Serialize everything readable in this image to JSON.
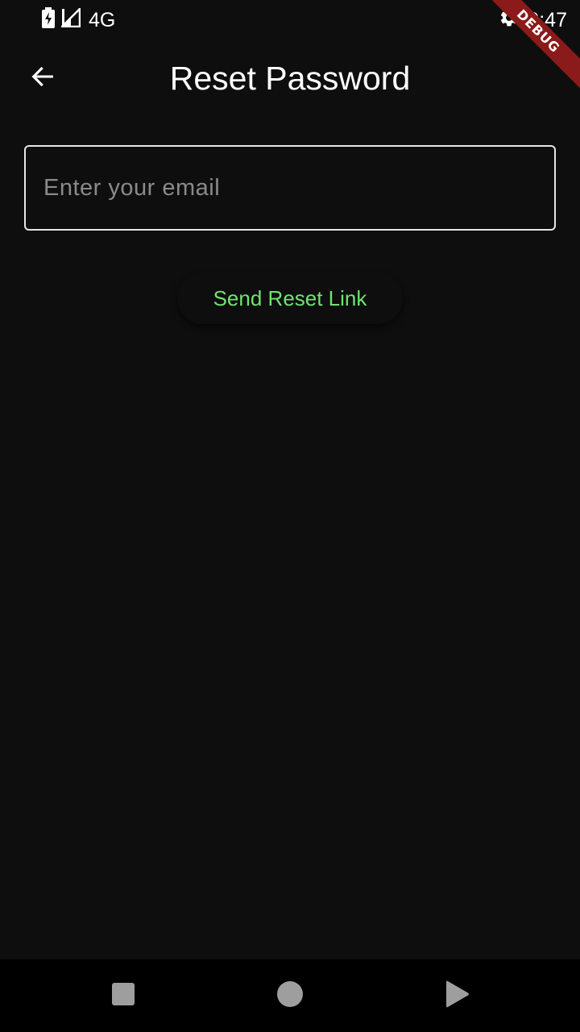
{
  "status_bar": {
    "network": "4G",
    "time": "9:47",
    "icons": [
      "battery-charging-icon",
      "signal-icon",
      "settings-icon"
    ]
  },
  "debug_banner": {
    "label": "DEBUG",
    "color": "#8b1a1a"
  },
  "app_bar": {
    "title": "Reset Password",
    "back_icon": "arrow-back-icon"
  },
  "form": {
    "email": {
      "value": "",
      "placeholder": "Enter your email"
    },
    "submit_label": "Send Reset Link"
  },
  "nav_bar": {
    "icons": [
      "recents-square-icon",
      "home-circle-icon",
      "back-triangle-icon"
    ]
  },
  "colors": {
    "background": "#0e0e0e",
    "accent": "#6fe36f",
    "field_border": "#e6e6e6",
    "placeholder": "#8a8a8a"
  }
}
